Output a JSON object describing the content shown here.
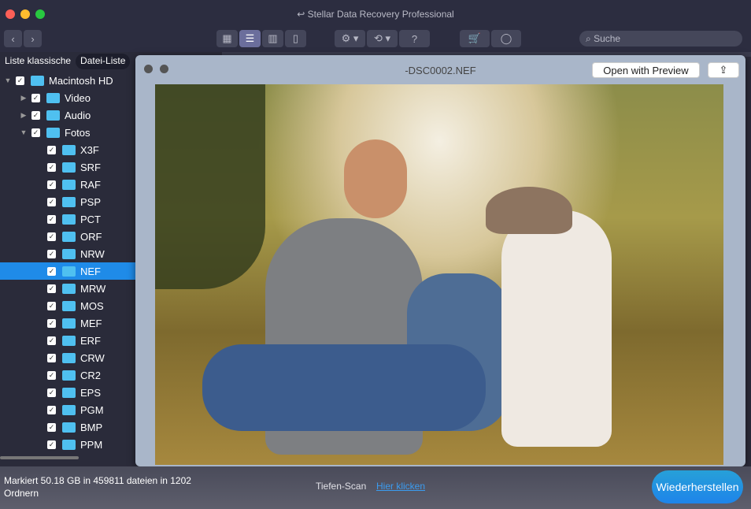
{
  "window": {
    "title": "Stellar Data Recovery Professional"
  },
  "toolbar": {
    "search_placeholder": "Suche",
    "help": "?"
  },
  "sidebar": {
    "tabs": [
      "Liste klassische",
      "Datei-Liste"
    ],
    "root": "Macintosh HD",
    "folders": [
      "Video",
      "Audio",
      "Fotos"
    ],
    "foto_types": [
      "X3F",
      "SRF",
      "RAF",
      "PSP",
      "PCT",
      "ORF",
      "NRW",
      "NEF",
      "MRW",
      "MOS",
      "MEF",
      "ERF",
      "CRW",
      "CR2",
      "EPS",
      "PGM",
      "BMP",
      "PPM"
    ],
    "selected": "NEF"
  },
  "preview": {
    "filename": "-DSC0002.NEF",
    "open_button": "Open with Preview"
  },
  "status": {
    "summary": "Markiert 50.18 GB in 459811 dateien in 1202 Ordnern",
    "deep_scan_label": "Tiefen-Scan",
    "deep_scan_link": "Hier klicken",
    "recover_button": "Wiederherstellen"
  },
  "colors": {
    "accent": "#1f8be8",
    "titlebar": "#2c2d40"
  }
}
